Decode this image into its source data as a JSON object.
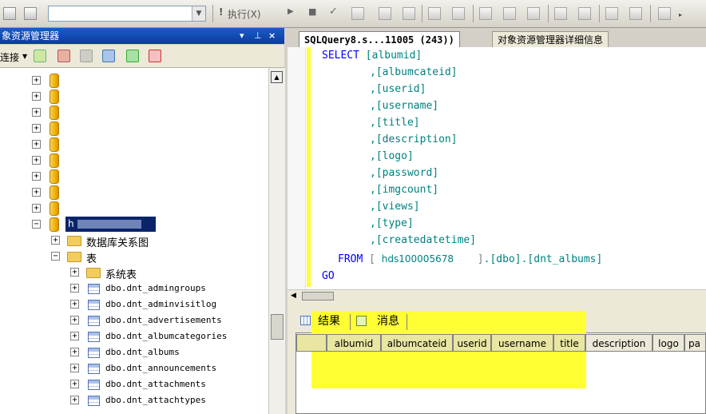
{
  "toolbar": {
    "execute_label": "执行(X)",
    "database_combo_value": ""
  },
  "object_explorer": {
    "title": "象资源管理器",
    "connect_label": "连接",
    "pin_glyph": "▾ ⊥ ×",
    "tree": {
      "selected_db_label": "h",
      "db_diagrams_label": "数据库关系图",
      "tables_label": "表",
      "system_tables_label": "系统表",
      "tables": [
        "dbo.dnt_admingroups",
        "dbo.dnt_adminvisitlog",
        "dbo.dnt_advertisements",
        "dbo.dnt_albumcategories",
        "dbo.dnt_albums",
        "dbo.dnt_announcements",
        "dbo.dnt_attachments",
        "dbo.dnt_attachtypes"
      ]
    }
  },
  "tabs": {
    "query_tab": "SQLQuery8.s...11005 (243))",
    "details_tab": "对象资源管理器详细信息"
  },
  "query": {
    "select_kw": "SELECT",
    "first_col": "[albumid]",
    "columns": [
      ",[albumcateid]",
      ",[userid]",
      ",[username]",
      ",[title]",
      ",[description]",
      ",[logo]",
      ",[password]",
      ",[imgcount]",
      ",[views]",
      ",[type]",
      ",[createdatetime]"
    ],
    "from_kw": "FROM",
    "db_name": "hds100005678",
    "from_rest": ".[dbo].[dnt_albums]",
    "go_kw": "GO"
  },
  "results": {
    "results_tab": "结果",
    "messages_tab": "消息",
    "columns": [
      "albumid",
      "albumcateid",
      "userid",
      "username",
      "title",
      "description",
      "logo",
      "pa"
    ]
  },
  "colors": {
    "highlight": "#ffff33",
    "keyword": "#0000ff",
    "identifier": "#008080",
    "selection": "#0a246a"
  }
}
